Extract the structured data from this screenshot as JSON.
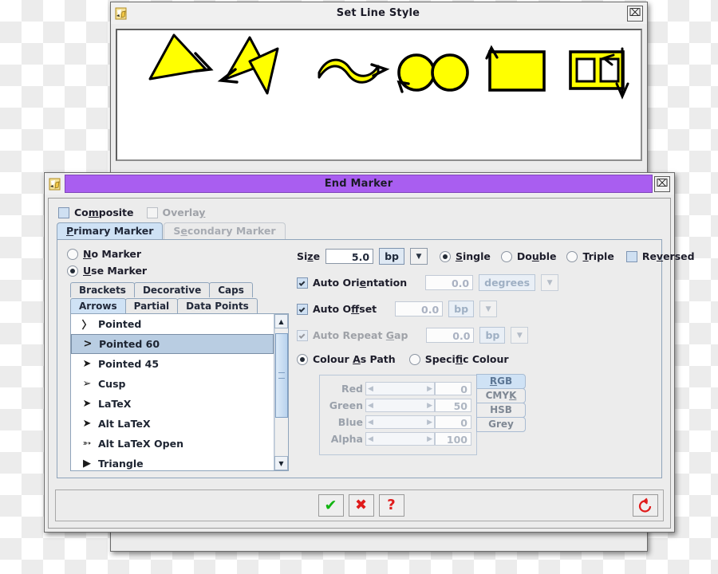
{
  "line_style_window": {
    "title": "Set Line Style",
    "icon": "app-icon",
    "close_label": "⌧",
    "buttons": {
      "ok": "✔",
      "cancel": "✖",
      "help": "?",
      "reset": "↺"
    },
    "preview_shapes": [
      "filled-triangle-arrow",
      "bowtie-double-arrow",
      "wave-arrow",
      "double-circle",
      "rectangle-arrow",
      "double-square-arrow",
      "down-arrow"
    ],
    "preview_colors": {
      "fill": "#ffff00",
      "stroke": "#000000"
    }
  },
  "end_marker": {
    "title": "End Marker",
    "title_accent": "#a95ef0",
    "close_label": "⌧",
    "composite": {
      "label_pre": "Co",
      "label_mn": "m",
      "label_post": "posite",
      "checked": false,
      "enabled": true
    },
    "overlay": {
      "label_pre": "Overla",
      "label_mn": "y",
      "label_post": "",
      "checked": false,
      "enabled": false
    },
    "marker_tabs": [
      {
        "label_pre": "",
        "label_mn": "P",
        "label_post": "rimary Marker",
        "selected": true,
        "enabled": true
      },
      {
        "label_pre": "S",
        "label_mn": "e",
        "label_post": "condary Marker",
        "selected": false,
        "enabled": false
      }
    ],
    "marker_mode": [
      {
        "label_pre": "",
        "label_mn": "N",
        "label_post": "o Marker",
        "selected": false
      },
      {
        "label_pre": "",
        "label_mn": "U",
        "label_post": "se Marker",
        "selected": true
      }
    ],
    "category_tabs_top": [
      {
        "label": "Brackets",
        "selected": false
      },
      {
        "label": "Decorative",
        "selected": false
      },
      {
        "label": "Caps",
        "selected": false
      }
    ],
    "category_tabs_bottom": [
      {
        "label": "Arrows",
        "selected": true
      },
      {
        "label": "Partial",
        "selected": false
      },
      {
        "label": "Data Points",
        "selected": false
      }
    ],
    "marker_list": [
      {
        "glyph": "〉",
        "label": "Pointed",
        "selected": false
      },
      {
        "glyph": ">",
        "label": "Pointed 60",
        "selected": true
      },
      {
        "glyph": "➤",
        "label": "Pointed 45",
        "selected": false
      },
      {
        "glyph": "➢",
        "label": "Cusp",
        "selected": false
      },
      {
        "glyph": "➤",
        "label": "LaTeX",
        "selected": false
      },
      {
        "glyph": "➤",
        "label": "Alt LaTeX",
        "selected": false
      },
      {
        "glyph": "➳",
        "label": "Alt LaTeX Open",
        "selected": false
      },
      {
        "glyph": "▶",
        "label": "Triangle",
        "selected": false
      }
    ],
    "size": {
      "label_pre": "Si",
      "label_mn": "z",
      "label_post": "e",
      "value": "5.0",
      "unit": "bp",
      "dropdown_icon": "▼"
    },
    "count_options": [
      {
        "label_pre": "",
        "label_mn": "S",
        "label_post": "ingle",
        "selected": true
      },
      {
        "label_pre": "Do",
        "label_mn": "u",
        "label_post": "ble",
        "selected": false
      },
      {
        "label_pre": "",
        "label_mn": "T",
        "label_post": "riple",
        "selected": false
      }
    ],
    "reversed": {
      "label_pre": "Re",
      "label_mn": "v",
      "label_post": "ersed",
      "checked": false
    },
    "auto_orientation": {
      "label_pre": "Auto Ori",
      "label_mn": "e",
      "label_post": "ntation",
      "checked": true,
      "enabled": true,
      "value": "0.0",
      "unit": "degrees",
      "dropdown_icon": "▼"
    },
    "auto_offset": {
      "label_pre": "Auto O",
      "label_mn": "ff",
      "label_post": "set",
      "checked": true,
      "enabled": true,
      "value": "0.0",
      "unit": "bp",
      "dropdown_icon": "▼"
    },
    "auto_repeat_gap": {
      "label_pre": "Auto Repeat ",
      "label_mn": "G",
      "label_post": "ap",
      "checked": true,
      "enabled": false,
      "value": "0.0",
      "unit": "bp",
      "dropdown_icon": "▼"
    },
    "colour_mode": [
      {
        "label_pre": "Colour ",
        "label_mn": "A",
        "label_post": "s Path",
        "selected": true
      },
      {
        "label_pre": "Speci",
        "label_mn": "f",
        "label_post": "ic Colour",
        "selected": false
      }
    ],
    "colour_panel": {
      "enabled": false,
      "channels": [
        {
          "name": "Red",
          "value": "0"
        },
        {
          "name": "Green",
          "value": "50"
        },
        {
          "name": "Blue",
          "value": "0"
        },
        {
          "name": "Alpha",
          "value": "100"
        }
      ],
      "left_arrow": "◀",
      "right_arrow": "▶",
      "model_tabs": [
        {
          "label_pre": "",
          "label_mn": "R",
          "label_post": "GB",
          "selected": true
        },
        {
          "label_pre": "CMY",
          "label_mn": "K",
          "label_post": "",
          "selected": false
        },
        {
          "label_pre": "HSB",
          "label_mn": "",
          "label_post": "",
          "selected": false
        },
        {
          "label_pre": "Grey",
          "label_mn": "",
          "label_post": "",
          "selected": false
        }
      ]
    },
    "buttons": {
      "ok": "✔",
      "cancel": "✖",
      "help": "?",
      "reset": "↺"
    },
    "scrollbar": {
      "up": "▲",
      "down": "▼"
    }
  }
}
